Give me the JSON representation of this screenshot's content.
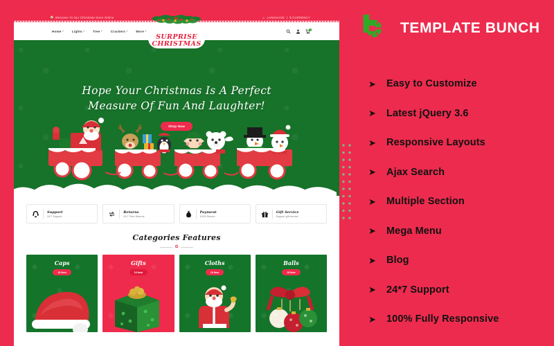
{
  "brand": {
    "name": "TEMPLATE BUNCH",
    "logo_icon": "b-letter-dotted-circle-logo",
    "accent_red": "#ed2b4e",
    "accent_green": "#2faa27"
  },
  "features": [
    {
      "label": "Easy to Customize",
      "bullet": "arrow-right-icon"
    },
    {
      "label": "Latest jQuery 3.6",
      "bullet": "arrow-right-icon"
    },
    {
      "label": "Responsive Layouts",
      "bullet": "arrow-right-icon"
    },
    {
      "label": "Ajax Search",
      "bullet": "arrow-right-icon"
    },
    {
      "label": "Multiple Section",
      "bullet": "arrow-right-icon"
    },
    {
      "label": "Mega Menu",
      "bullet": "arrow-right-icon"
    },
    {
      "label": "Blog",
      "bullet": "arrow-right-icon"
    },
    {
      "label": "24*7 Support",
      "bullet": "arrow-right-icon"
    },
    {
      "label": "100% Fully Responsive",
      "bullet": "arrow-right-icon"
    }
  ],
  "preview": {
    "topbar": {
      "home_icon": "home-icon",
      "welcome": "Welcome To Our Christmas Store Online",
      "globe_icon": "globe-icon",
      "language": "LANGUAGE",
      "separator": "|",
      "currency": "$ CURRENCY",
      "caret": "⌄"
    },
    "nav": {
      "menu": [
        {
          "label": "Home",
          "caret": "▾"
        },
        {
          "label": "Lights",
          "caret": "▾"
        },
        {
          "label": "Tree",
          "caret": "▾"
        },
        {
          "label": "Crackers",
          "caret": "▾"
        },
        {
          "label": "More",
          "caret": "▾"
        }
      ],
      "icons": [
        "search-icon",
        "user-account-icon",
        "shopping-cart-icon"
      ],
      "cart_count": "0"
    },
    "logo": {
      "line1": "SURPRISE",
      "line2": "CHRISTMAS",
      "ornament": "christmas-wreath"
    },
    "hero": {
      "title_line1": "Hope Your Christmas Is A Perfect",
      "title_line2": "Measure Of Fun And Laughter!",
      "button": "Shop Now",
      "illustration": "christmas-train-with-santa-reindeer-penguin-elf-polarbear-snowmen"
    },
    "services": [
      {
        "icon": "headset-icon",
        "title": "Support",
        "subtitle": "24*7 Support"
      },
      {
        "icon": "return-arrows-icon",
        "title": "Returns",
        "subtitle": "24*7 Free Returns"
      },
      {
        "icon": "money-bag-icon",
        "title": "Payment",
        "subtitle": "100% Secure"
      },
      {
        "icon": "gift-box-icon",
        "title": "Gift Service",
        "subtitle": "Support gift service"
      }
    ],
    "categories": {
      "heading": "Categories Features",
      "divider_icon": "bell-divider-icon",
      "items": [
        {
          "name": "Caps",
          "count": "19 Item",
          "art": "santa-hat",
          "style": "green"
        },
        {
          "name": "Gifts",
          "count": "19 Item",
          "art": "gift-box",
          "style": "red"
        },
        {
          "name": "Cloths",
          "count": "19 Item",
          "art": "santa-with-bell",
          "style": "green"
        },
        {
          "name": "Balls",
          "count": "19 Item",
          "art": "ornaments-with-bow",
          "style": "green"
        }
      ]
    }
  }
}
